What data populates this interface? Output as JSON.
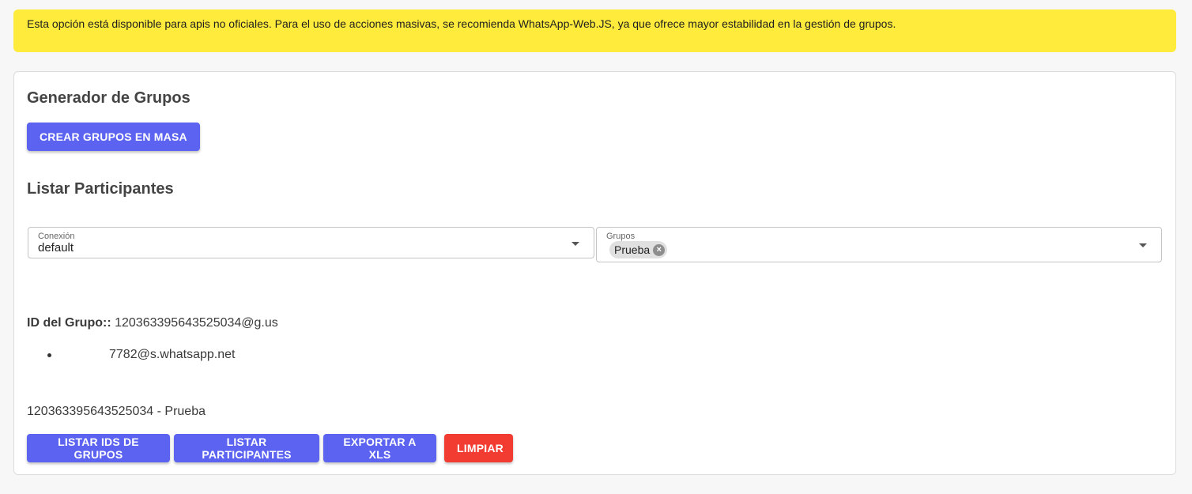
{
  "alert": {
    "text": "Esta opción está disponible para apis no oficiales. Para el uso de acciones masivas, se recomienda WhatsApp-Web.JS, ya que ofrece mayor estabilidad en la gestión de grupos."
  },
  "generator": {
    "title": "Generador de Grupos",
    "create_button": "Crear grupos en masa"
  },
  "participants": {
    "title": "Listar Participantes",
    "connection": {
      "label": "Conexión",
      "value": "default"
    },
    "groups": {
      "label": "Grupos",
      "chip": "Prueba"
    },
    "group_id_label": "ID del Grupo::",
    "group_id_value": "120363395643525034@g.us",
    "member": "7782@s.whatsapp.net",
    "group_summary": "120363395643525034 - Prueba"
  },
  "actions": {
    "list_ids": "Listar IDs de Grupos",
    "list_participants": "Listar Participantes",
    "export": "Exportar a XLS",
    "clear": "Limpiar"
  },
  "colors": {
    "alert_bg": "#ffeb3b",
    "primary": "#5b63f0",
    "danger": "#f23c32"
  }
}
